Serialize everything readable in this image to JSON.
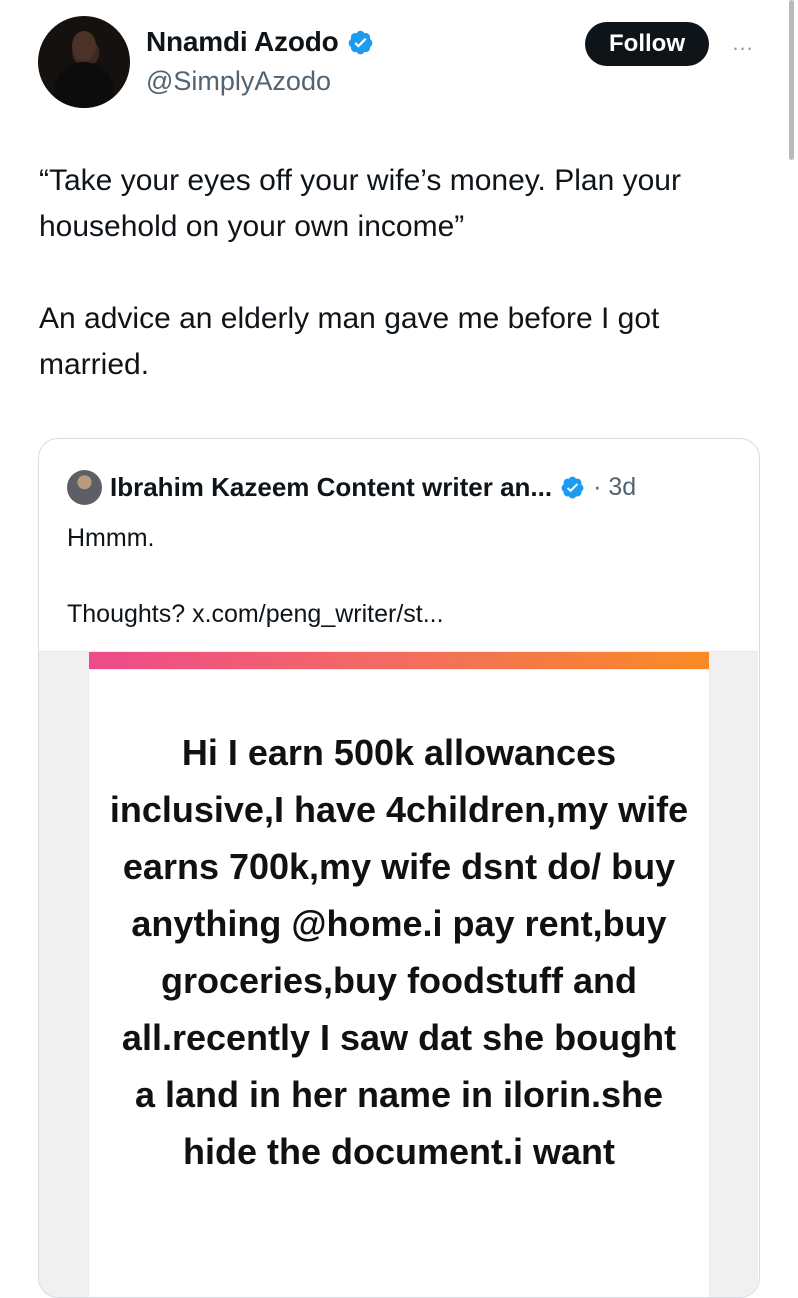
{
  "author": {
    "display_name": "Nnamdi Azodo",
    "handle": "@SimplyAzodo",
    "verified": true
  },
  "actions": {
    "follow_label": "Follow",
    "more_label": "..."
  },
  "tweet": {
    "text": "“Take your eyes off your wife’s money. Plan your household on your own income”\n\nAn advice an elderly man gave me before I got married."
  },
  "quote": {
    "author_name": "Ibrahim Kazeem Content writer an...",
    "verified": true,
    "time": "· 3d",
    "text": "Hmmm.\n\nThoughts? x.com/peng_writer/st..."
  },
  "media": {
    "text": "Hi I earn 500k allowances inclusive,I have 4children,my wife earns 700k,my wife dsnt do/ buy anything @home.i pay rent,buy groceries,buy foodstuff and all.recently I saw dat she bought a land in her name in ilorin.she hide the document.i want"
  },
  "colors": {
    "text": "#0f1419",
    "secondary": "#536471",
    "verified": "#1d9bf0",
    "follow_bg": "#0f1419",
    "card_border": "#d7dde1"
  },
  "icons": {
    "verified": "verified-badge-icon",
    "more": "more-horizontal-icon"
  }
}
